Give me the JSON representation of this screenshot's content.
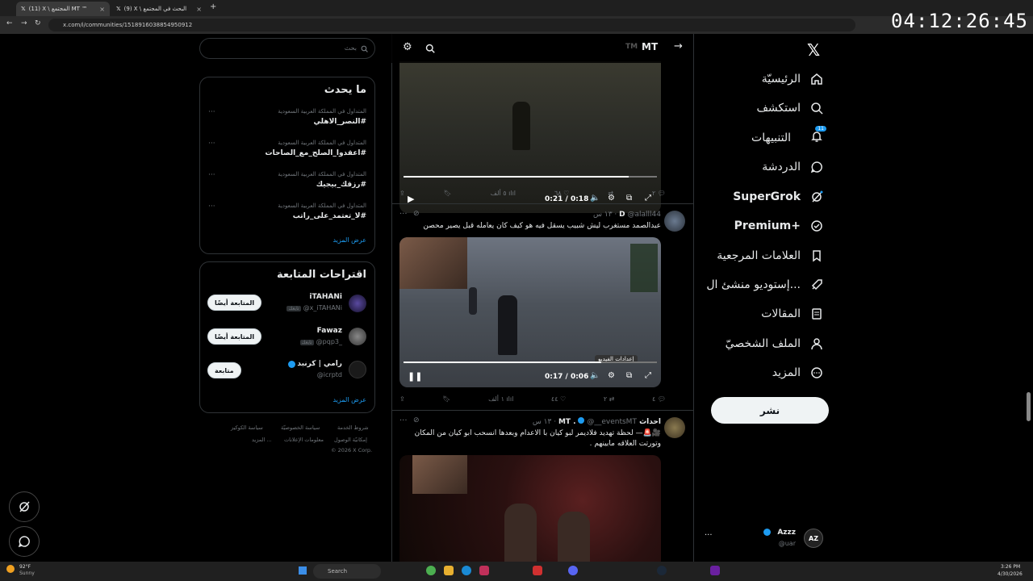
{
  "browser": {
    "tabs": [
      {
        "label": "(11) X \\ المجتمع MT ™",
        "active": true
      },
      {
        "label": "(9) X \\ البحث في المجتمع",
        "active": false
      }
    ],
    "url": "x.com/i/communities/1518916038854950912",
    "clock": "04:12:26:45"
  },
  "nav": {
    "items": [
      {
        "label": "الرئيسيّة",
        "icon": "home-icon"
      },
      {
        "label": "استكشف",
        "icon": "search-icon"
      },
      {
        "label": "التنبيهات",
        "icon": "bell-icon",
        "badge": "11"
      },
      {
        "label": "الدردشة",
        "icon": "chat-icon"
      },
      {
        "label": "SuperGrok",
        "icon": "grok-icon"
      },
      {
        "label": "Premium+",
        "icon": "verified-icon"
      },
      {
        "label": "العلامات المرجعية",
        "icon": "bookmark-icon"
      },
      {
        "label": "إستوديو منشئ ال...",
        "icon": "rocket-icon"
      },
      {
        "label": "المقالات",
        "icon": "article-icon"
      },
      {
        "label": "الملف الشخصيّ",
        "icon": "profile-icon"
      },
      {
        "label": "المزيد",
        "icon": "more-icon"
      }
    ],
    "post_button": "نشر",
    "account": {
      "name": "Azzz",
      "handle": "@uar"
    }
  },
  "header": {
    "title": "MT",
    "tm": "TM"
  },
  "tweets": [
    {
      "video_time": "0:21 / 0:18",
      "progress": 0.89,
      "stats": {
        "replies": "٢",
        "reposts": "",
        "likes": "٦٨",
        "views": "٥ ألف"
      }
    },
    {
      "author": "D",
      "handle": "@alalll44",
      "time": "١٣ س",
      "text": "عبدالصمد مستغرب ليش شبيب يسقل فيه هو كيف كان يعامله قبل يصير محصن",
      "video_time": "0:17 / 0:06",
      "progress": 0.78,
      "tooltip": "إعدادات الفيديو",
      "stats": {
        "replies": "٤",
        "reposts": "٢",
        "likes": "٤٤",
        "views": "١ ألف"
      }
    },
    {
      "author": "احداث MT .",
      "handle": "@__eventsMT",
      "time": "١٣ س",
      "text_line1": "🎥🚨— لحظة تهديد فلاديمر لبو كيان با الاعدام وبعدها انسحب ابو كيان من المكان",
      "text_line2": "وتورتت العلاقه مابينهم ."
    }
  ],
  "search": {
    "placeholder": "بحث"
  },
  "trends": {
    "title": "ما يحدث",
    "items": [
      {
        "meta": "المتداول في المملكة العربية السعودية",
        "name": "#النصر_الاهلي"
      },
      {
        "meta": "المتداول في المملكة العربية السعودية",
        "name": "#اعقدوا_الصلح_مع_الصاحات"
      },
      {
        "meta": "المتداول في المملكة العربية السعودية",
        "name": "#رزقك_بيجيك"
      },
      {
        "meta": "المتداول في المملكة العربية السعودية",
        "name": "#لا_تعتمد_على_راتب"
      }
    ],
    "show_more": "عرض المزيد"
  },
  "suggestions": {
    "title": "اقتراحات المتابعة",
    "items": [
      {
        "name": "iTAHANi",
        "handle": "@x_iTAHANi",
        "tag": "تابعك",
        "button": "المتابعة أيضًا"
      },
      {
        "name": "Fawaz",
        "handle": "@pqp3_",
        "tag": "تابعك",
        "button": "المتابعة أيضًا"
      },
      {
        "name": "رامي | كرنبد",
        "handle": "@icrptd",
        "tag": "",
        "button": "متابعة"
      }
    ],
    "show_more": "عرض المزيد"
  },
  "footer": {
    "links": [
      "شروط الخدمة",
      "سياسة الخصوصيّة",
      "سياسة الكوكيز",
      "إمكانيّة الوصول",
      "معلومات الإعلانات",
      "المزيد ..."
    ],
    "copyright": "© 2026 X Corp."
  },
  "taskbar": {
    "weather_temp": "92°F",
    "weather_desc": "Sunny",
    "search": "Search",
    "time": "3:26 PM",
    "date": "4/30/2026"
  },
  "colors": {
    "accent": "#1d9bf0",
    "bg": "#000000",
    "border": "#2f3336"
  }
}
